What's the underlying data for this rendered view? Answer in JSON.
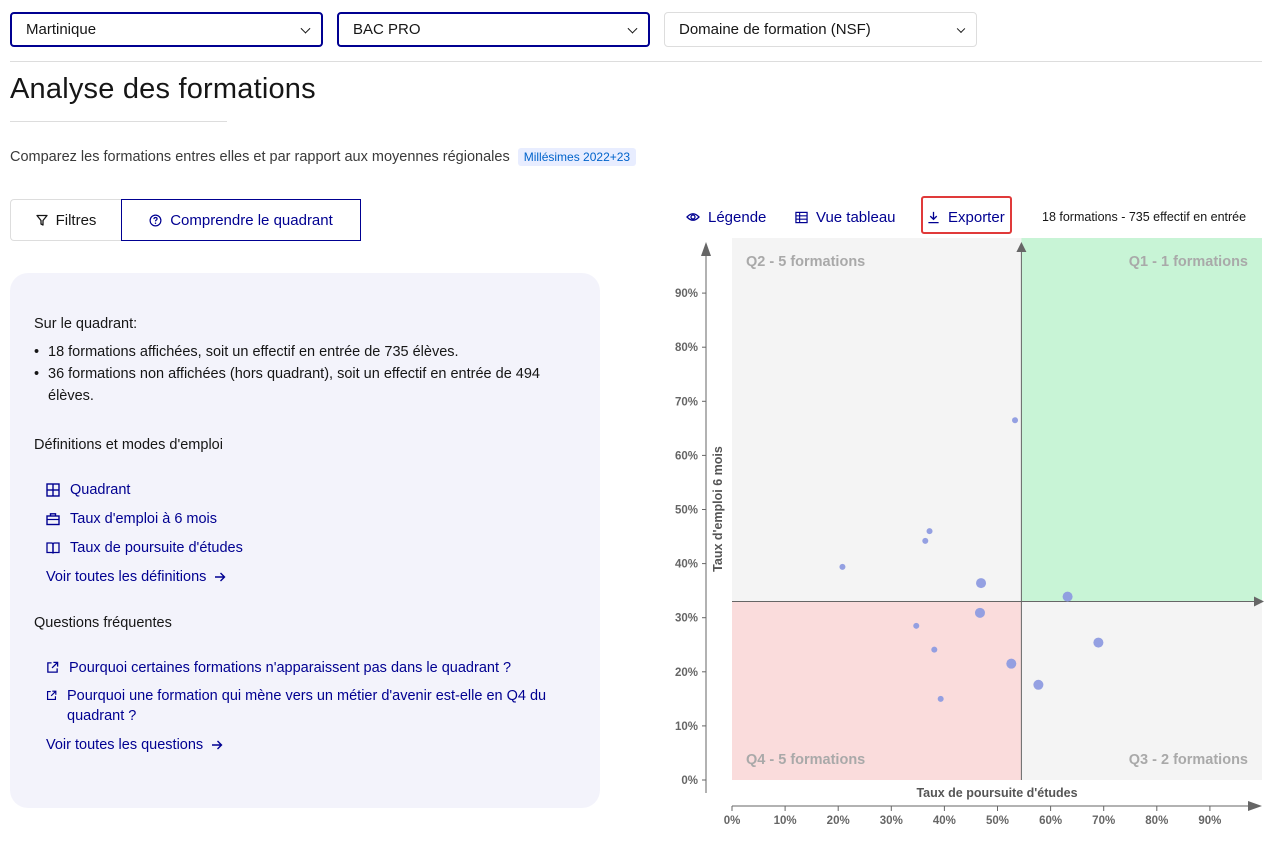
{
  "filters": {
    "region": "Martinique",
    "diplome": "BAC PRO",
    "domaine": "Domaine de formation (NSF)"
  },
  "page": {
    "title": "Analyse des formations",
    "subtitle": "Comparez les formations entres elles et par rapport aux moyennes régionales",
    "badge": "Millésimes 2022+23"
  },
  "tabs": {
    "filtres": "Filtres",
    "comprendre": "Comprendre le quadrant"
  },
  "panel": {
    "quadrant_heading": "Sur le quadrant:",
    "bullets": [
      "18 formations affichées, soit un effectif en entrée de 735 élèves.",
      "36 formations non affichées (hors quadrant), soit un effectif en entrée de 494 élèves."
    ],
    "definitions_heading": "Définitions et modes d'emploi",
    "definitions": [
      {
        "label": "Quadrant",
        "icon": "grid-icon"
      },
      {
        "label": "Taux d'emploi à 6 mois",
        "icon": "briefcase-icon"
      },
      {
        "label": "Taux de poursuite d'études",
        "icon": "book-icon"
      }
    ],
    "see_all_definitions": "Voir toutes les définitions",
    "faq_heading": "Questions fréquentes",
    "faq": [
      "Pourquoi certaines formations n'apparaissent pas dans le quadrant ?",
      "Pourquoi une formation qui mène vers un métier d'avenir est-elle en Q4 du quadrant ?"
    ],
    "see_all_questions": "Voir toutes les questions"
  },
  "toolbar": {
    "legend": "Légende",
    "table_view": "Vue tableau",
    "export": "Exporter",
    "count": "18 formations - 735 effectif en entrée"
  },
  "colors": {
    "accent": "#000091",
    "q1": "#c8f4d6",
    "q4": "#fadcdc",
    "neutral": "#f4f4f4",
    "point": "#8e9be0",
    "highlight": "#e03a3a"
  },
  "chart_data": {
    "type": "scatter",
    "xlabel": "Taux de poursuite d'études",
    "ylabel": "Taux d'emploi 6 mois",
    "xlim": [
      0,
      100
    ],
    "ylim": [
      0,
      100
    ],
    "x_ticks": [
      "0%",
      "10%",
      "20%",
      "30%",
      "40%",
      "50%",
      "60%",
      "70%",
      "80%",
      "90%"
    ],
    "y_ticks": [
      "0%",
      "10%",
      "20%",
      "30%",
      "40%",
      "50%",
      "60%",
      "70%",
      "80%",
      "90%"
    ],
    "mean_x": 54.5,
    "mean_y": 33.0,
    "quadrants": {
      "q1": "Q1 - 1 formations",
      "q2": "Q2 - 5 formations",
      "q3": "Q3 - 2 formations",
      "q4": "Q4 - 5 formations"
    },
    "points": [
      {
        "x": 53.3,
        "y": 66.5,
        "size": "small"
      },
      {
        "x": 37.2,
        "y": 46.0,
        "size": "small"
      },
      {
        "x": 36.4,
        "y": 44.2,
        "size": "small"
      },
      {
        "x": 20.8,
        "y": 39.4,
        "size": "small"
      },
      {
        "x": 46.9,
        "y": 36.4,
        "size": "medium"
      },
      {
        "x": 63.2,
        "y": 33.9,
        "size": "medium"
      },
      {
        "x": 46.7,
        "y": 30.9,
        "size": "medium"
      },
      {
        "x": 34.7,
        "y": 28.5,
        "size": "small"
      },
      {
        "x": 69.0,
        "y": 25.4,
        "size": "medium"
      },
      {
        "x": 38.1,
        "y": 24.1,
        "size": "small"
      },
      {
        "x": 52.6,
        "y": 21.5,
        "size": "medium"
      },
      {
        "x": 57.7,
        "y": 17.6,
        "size": "medium"
      },
      {
        "x": 39.3,
        "y": 15.0,
        "size": "small"
      }
    ]
  }
}
